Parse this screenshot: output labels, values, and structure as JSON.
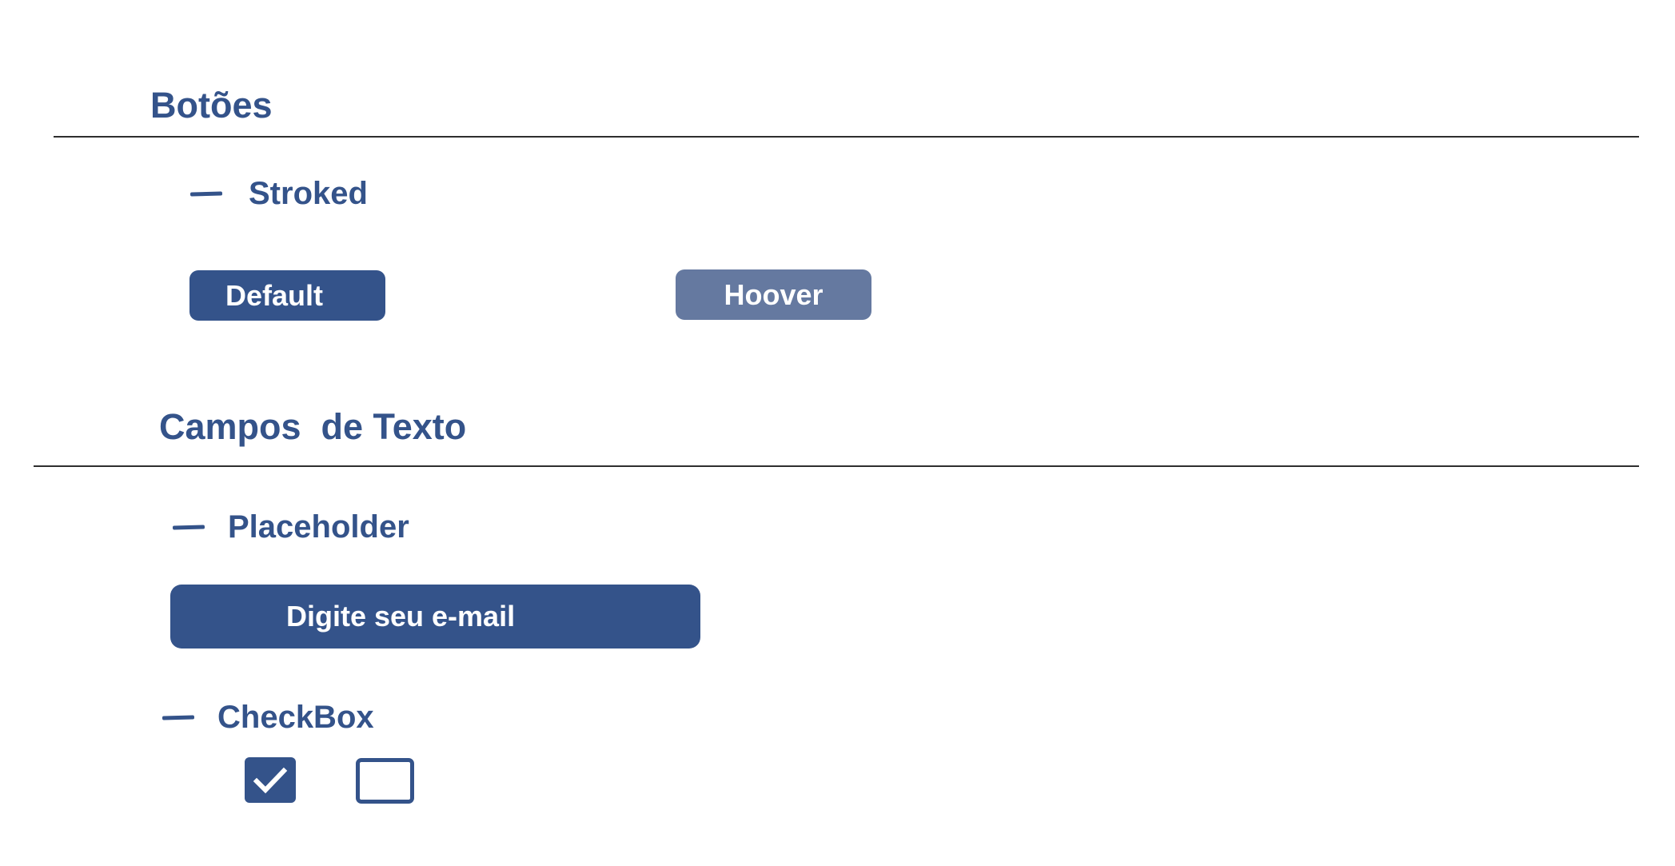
{
  "sections": {
    "buttons": {
      "title": "Botões",
      "stroked": {
        "label": "Stroked",
        "default_button_label": "Default",
        "hover_button_label": "Hoover"
      }
    },
    "text_fields": {
      "title": "Campos  de Texto",
      "placeholder": {
        "label": "Placeholder",
        "email_placeholder": "Digite seu e-mail"
      },
      "checkbox": {
        "label": "CheckBox",
        "items": [
          {
            "checked": true
          },
          {
            "checked": false
          }
        ]
      }
    }
  },
  "colors": {
    "primary": "#34538a",
    "primary_hover": "#6579a0",
    "divider": "#2e2e2e",
    "on_primary": "#ffffff"
  },
  "icons": {
    "bullet": "dash-icon",
    "check": "checkmark-icon"
  }
}
